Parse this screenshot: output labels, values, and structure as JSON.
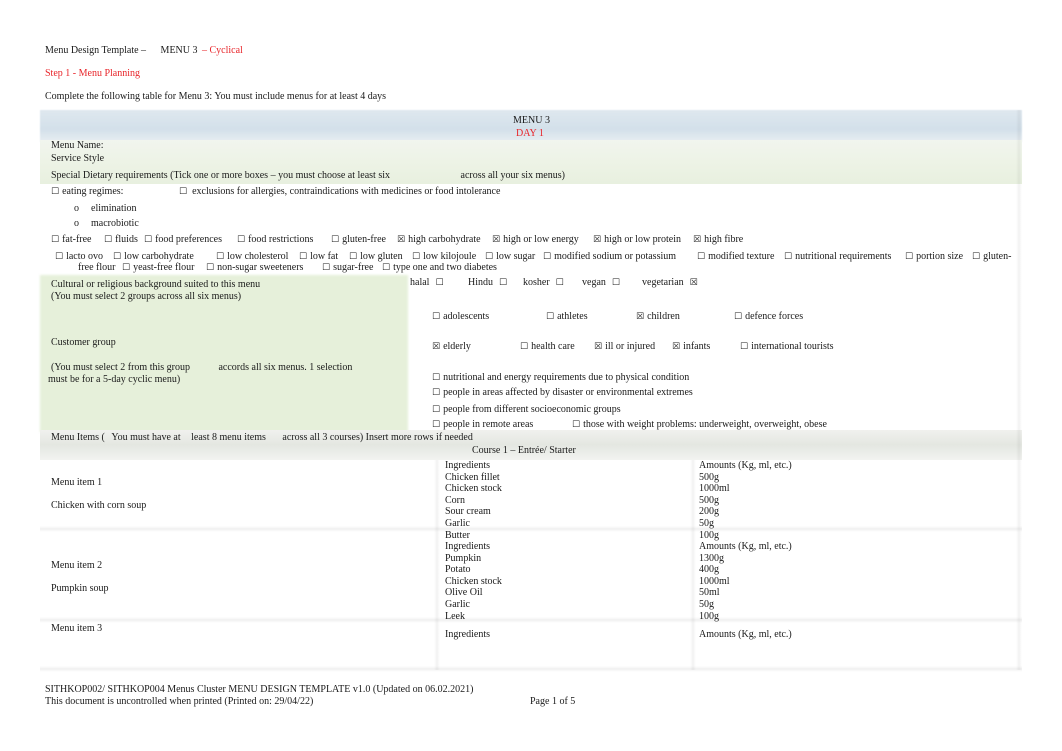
{
  "header": {
    "title_prefix": "Menu Design Template –",
    "title_menu": "MENU 3",
    "title_suffix": "– Cyclical",
    "step": "Step 1 - Menu Planning",
    "instruction": "Complete the following table for Menu 3: You must include menus for at least 4 days"
  },
  "table": {
    "menu_label": "MENU 3",
    "day_label": "DAY 1",
    "menu_name_label": "Menu Name:",
    "service_style_label": "Service Style",
    "special_dietary_label": "Special Dietary requirements (Tick one or more boxes – you must choose at least six",
    "special_dietary_suffix": "across all your six menus)",
    "eating_regimes": {
      "label": "eating regimes:",
      "checked": false
    },
    "exclusions": {
      "label": "exclusions for allergies, contraindications with medicines or food intolerance",
      "checked": false
    },
    "sub_regimes": [
      {
        "bullet": "o",
        "label": "elimination"
      },
      {
        "bullet": "o",
        "label": "macrobiotic"
      }
    ],
    "diet_row1": [
      {
        "label": "fat-free",
        "checked": false
      },
      {
        "label": "fluids",
        "checked": false
      },
      {
        "label": "food preferences",
        "checked": false
      },
      {
        "label": "food restrictions",
        "checked": false
      },
      {
        "label": "gluten-free",
        "checked": false
      },
      {
        "label": "high carbohydrate",
        "checked": true
      },
      {
        "label": "high or low energy",
        "checked": true
      },
      {
        "label": "high or low protein",
        "checked": true
      },
      {
        "label": "high fibre",
        "checked": true
      }
    ],
    "diet_row2": [
      {
        "label": "lacto ovo",
        "checked": false
      },
      {
        "label": "low carbohydrate",
        "checked": false
      },
      {
        "label": "low cholesterol",
        "checked": false
      },
      {
        "label": "low fat",
        "checked": false
      },
      {
        "label": "low gluten",
        "checked": false
      },
      {
        "label": "low kilojoule",
        "checked": false
      },
      {
        "label": "low sugar",
        "checked": false
      },
      {
        "label": "modified sodium or potassium",
        "checked": false
      },
      {
        "label": "modified texture",
        "checked": false
      },
      {
        "label": "nutritional requirements",
        "checked": false
      },
      {
        "label": "portion size",
        "checked": false
      },
      {
        "label": "gluten-",
        "checked": false
      }
    ],
    "diet_row3": [
      {
        "label": "free flour",
        "checked": null
      },
      {
        "label": "yeast-free flour",
        "checked": false
      },
      {
        "label": "non-sugar sweeteners",
        "checked": false
      },
      {
        "label": "sugar-free",
        "checked": false
      },
      {
        "label": "type one and two diabetes",
        "checked": false
      }
    ],
    "cultural_label": "Cultural or religious background suited to this menu",
    "cultural_note": "(You must select 2 groups across all six menus)",
    "cultural_options": [
      {
        "label": "halal",
        "checked": false
      },
      {
        "label": "Hindu",
        "checked": false
      },
      {
        "label": "kosher",
        "checked": false
      },
      {
        "label": "vegan",
        "checked": false
      },
      {
        "label": "vegetarian",
        "checked": true
      }
    ],
    "customer_group_label": "Customer group",
    "customer_group_note_a": "(You must select 2 from this group",
    "customer_group_note_b": "accords all six menus. 1 selection",
    "customer_group_note_c": "must be for a 5-day cyclic menu)",
    "customer_row1": [
      {
        "label": "adolescents",
        "checked": false
      },
      {
        "label": "athletes",
        "checked": false
      },
      {
        "label": "children",
        "checked": true
      },
      {
        "label": "defence forces",
        "checked": false
      }
    ],
    "customer_row2": [
      {
        "label": "elderly",
        "checked": true
      },
      {
        "label": "health care",
        "checked": false
      },
      {
        "label": "ill or injured",
        "checked": true
      },
      {
        "label": "infants",
        "checked": true
      },
      {
        "label": "international tourists",
        "checked": false
      }
    ],
    "customer_list": [
      {
        "label": "nutritional and energy requirements due to physical condition",
        "checked": false
      },
      {
        "label": "people in areas affected by disaster or environmental extremes",
        "checked": false
      },
      {
        "label": "people from different socioeconomic groups",
        "checked": false
      }
    ],
    "customer_last": [
      {
        "label": "people in remote areas",
        "checked": false
      },
      {
        "label": "those with weight problems: underweight, overweight, obese",
        "checked": false
      }
    ],
    "menu_items_a": "Menu Items (",
    "menu_items_b": "You must have at",
    "menu_items_c": "least 8 menu items",
    "menu_items_d": "across all 3 courses) Insert more rows if needed",
    "course1_label": "Course 1 – Entrée/ Starter",
    "ingredients_header": "Ingredients",
    "amounts_header": "Amounts (Kg, ml, etc.)",
    "menu_items": [
      {
        "label": "Menu item 1",
        "name": "Chicken with corn soup",
        "ingredients": [
          {
            "name": "Chicken fillet",
            "amount": "500g"
          },
          {
            "name": "Chicken stock",
            "amount": "1000ml"
          },
          {
            "name": "Corn",
            "amount": "500g"
          },
          {
            "name": "Sour cream",
            "amount": "200g"
          },
          {
            "name": "Garlic",
            "amount": "50g"
          },
          {
            "name": "Butter",
            "amount": "100g"
          }
        ]
      },
      {
        "label": "Menu item 2",
        "name": "Pumpkin soup",
        "ingredients": [
          {
            "name": "Pumpkin",
            "amount": "1300g"
          },
          {
            "name": "Potato",
            "amount": "400g"
          },
          {
            "name": "Chicken stock",
            "amount": "1000ml"
          },
          {
            "name": "Olive Oil",
            "amount": "50ml"
          },
          {
            "name": "Garlic",
            "amount": "50g"
          },
          {
            "name": "Leek",
            "amount": "100g"
          }
        ]
      },
      {
        "label": "Menu item 3",
        "name": "",
        "ingredients": []
      }
    ]
  },
  "footer": {
    "line1": "SITHKOP002/ SITHKOP004 Menus Cluster MENU DESIGN TEMPLATE v1.0 (Updated on 06.02.2021)",
    "line2": "This document is uncontrolled when printed (Printed on: 29/04/22)",
    "page": "Page 1 of 5"
  },
  "colors": {
    "accent_red": "#e8252a",
    "header_blue": "#d3e0ea",
    "section_green": "#e6f0da"
  },
  "icons": {
    "unchecked": "☐",
    "checked": "☒"
  }
}
